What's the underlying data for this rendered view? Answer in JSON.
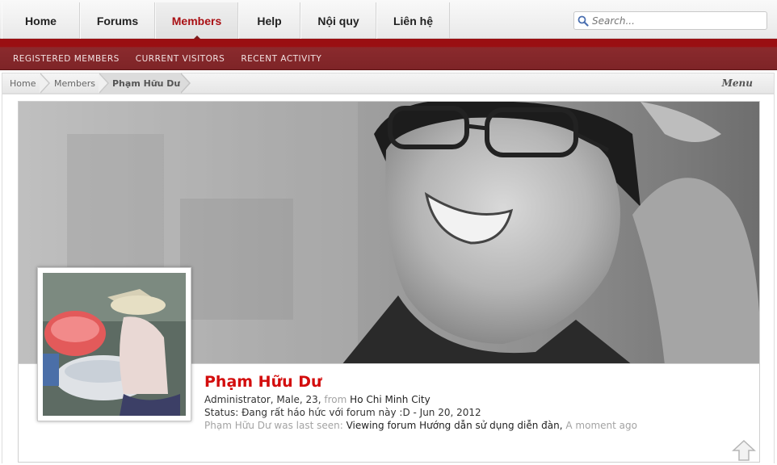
{
  "nav": {
    "tabs": [
      {
        "label": "Home"
      },
      {
        "label": "Forums"
      },
      {
        "label": "Members"
      },
      {
        "label": "Help"
      },
      {
        "label": "Nội quy"
      },
      {
        "label": "Liên hệ"
      }
    ],
    "active_tab": "Members",
    "search_placeholder": "Search..."
  },
  "subnav": {
    "links": [
      "REGISTERED MEMBERS",
      "CURRENT VISITORS",
      "RECENT ACTIVITY"
    ]
  },
  "breadcrumb": {
    "items": [
      "Home",
      "Members",
      "Phạm Hữu Dư"
    ],
    "menu_label": "Menu"
  },
  "profile": {
    "name": "Phạm Hữu Dư",
    "role_line": "Administrator, Male, 23,",
    "from_label": "from",
    "location": "Ho Chi Minh City",
    "status_label": "Status:",
    "status_text": "Đang rất háo hức với forum này :D - Jun 20, 2012",
    "last_seen_label": "Phạm Hữu Dư was last seen:",
    "activity_link": "Viewing forum",
    "activity_forum": "Hướng dẫn sử dụng diễn đàn,",
    "activity_time": "A moment ago"
  },
  "colors": {
    "accent": "#a90f13",
    "name": "#d30d0d",
    "subnav": "#8a2a2d"
  },
  "icons": {
    "search": "search-icon",
    "scroll_top": "scroll-to-top-icon"
  }
}
